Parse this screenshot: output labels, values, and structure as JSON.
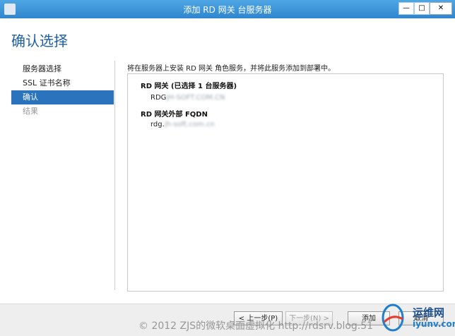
{
  "window": {
    "title": "添加 RD 网关 台服务器"
  },
  "page": {
    "heading": "确认选择"
  },
  "nav": {
    "items": [
      {
        "label": "服务器选择"
      },
      {
        "label": "SSL 证书名称"
      },
      {
        "label": "确认"
      },
      {
        "label": "结果"
      }
    ]
  },
  "content": {
    "description": "将在服务器上安装 RD 网关 角色服务，并将此服务添加到部署中。",
    "sections": [
      {
        "header": "RD 网关 (已选择 1 台服务器)",
        "value_prefix": "RDG",
        "value_blurred": "JH-SOFT.COM.CN"
      },
      {
        "header": "RD 网关外部 FQDN",
        "value_prefix": "rdg.",
        "value_blurred": "jh-soft.com.cn"
      }
    ]
  },
  "buttons": {
    "previous": "< 上一步(P)",
    "next": "下一步(N) >",
    "add": "添加",
    "cancel": "取消"
  },
  "watermark": {
    "text": "© 2012 ZJS的微软桌面虚拟化 http://rdsrv.blog.51"
  },
  "logo": {
    "text": "运维网",
    "sub": "iyunv.com"
  }
}
